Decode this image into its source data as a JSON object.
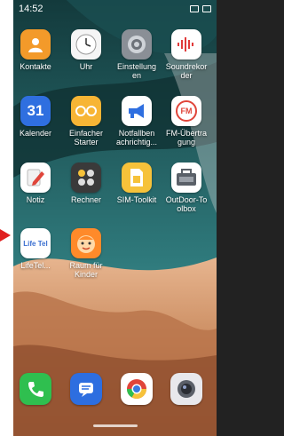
{
  "status": {
    "time": "14:52"
  },
  "apps": [
    {
      "label": "Kontakte",
      "icon": "contacts-icon"
    },
    {
      "label": "Uhr",
      "icon": "clock-icon"
    },
    {
      "label": "Einstellung\nen",
      "icon": "settings-gear-icon"
    },
    {
      "label": "Soundrekor\nder",
      "icon": "sound-recorder-icon"
    },
    {
      "label": "Kalender",
      "icon": "calendar-icon",
      "day": "31"
    },
    {
      "label": "Einfacher\nStarter",
      "icon": "simple-starter-icon"
    },
    {
      "label": "Notfallben\nachrichtig...",
      "icon": "megaphone-icon"
    },
    {
      "label": "FM-Übertra\ngung",
      "icon": "fm-radio-icon",
      "text": "FM"
    },
    {
      "label": "Notiz",
      "icon": "notes-pencil-icon"
    },
    {
      "label": "Rechner",
      "icon": "calculator-icon"
    },
    {
      "label": "SIM-Toolkit",
      "icon": "sim-card-icon"
    },
    {
      "label": "OutDoor-To\nolbox",
      "icon": "toolbox-icon"
    },
    {
      "label": "LifeTel...",
      "icon": "lifetel-icon",
      "text": "Life Tel"
    },
    {
      "label": "Raum für\nKinder",
      "icon": "kids-face-icon"
    }
  ],
  "dock": [
    {
      "icon": "phone-icon"
    },
    {
      "icon": "messages-icon"
    },
    {
      "icon": "chrome-icon"
    },
    {
      "icon": "camera-icon"
    }
  ],
  "colors": {
    "contacts": "#f39a2a",
    "clock": "#f5f5f5",
    "settings": "#8a8f96",
    "recorder": "#ffffff",
    "calendar": "#2f6fe0",
    "starter": "#f7b535",
    "emergency": "#ffffff",
    "fm": "#ffffff",
    "notes": "#ffffff",
    "calculator": "#3a3a3a",
    "sim": "#f6c23a",
    "toolbox": "#ffffff",
    "lifetel": "#ffffff",
    "kids": "#ff8a2a",
    "phone": "#2fbf4f",
    "messages": "#2d6ee0",
    "chrome": "#ffffff",
    "camera": "#e8e8ec",
    "arrow": "#e02020"
  }
}
